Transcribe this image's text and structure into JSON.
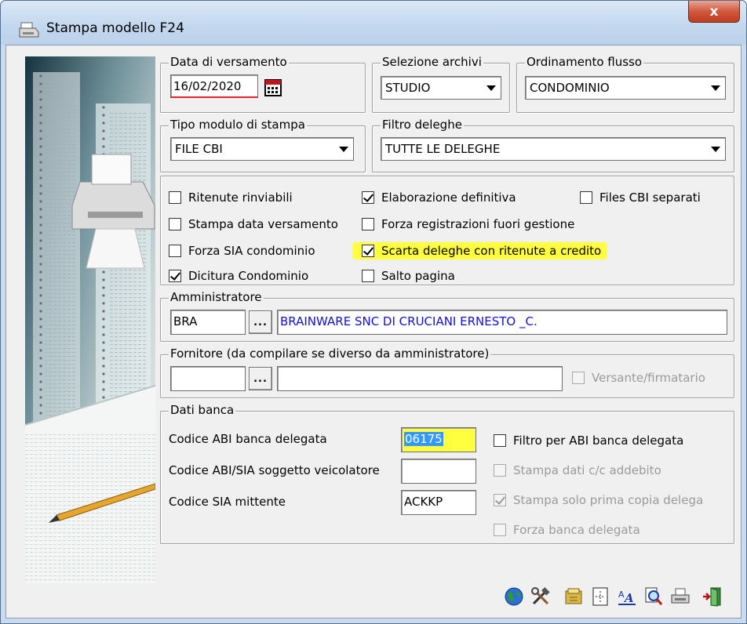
{
  "window": {
    "title": "Stampa modello F24",
    "close_label": "x"
  },
  "data_versamento": {
    "legend": "Data di versamento",
    "value": "16/02/2020"
  },
  "selezione_archivi": {
    "legend": "Selezione archivi",
    "value": "STUDIO"
  },
  "ordinamento_flusso": {
    "legend": "Ordinamento flusso",
    "value": "CONDOMINIO"
  },
  "tipo_modulo": {
    "legend": "Tipo modulo di stampa",
    "value": "FILE CBI"
  },
  "filtro_deleghe": {
    "legend": "Filtro deleghe",
    "value": "TUTTE LE DELEGHE"
  },
  "options": {
    "ritenute_rinviabili": {
      "label": "Ritenute rinviabili",
      "checked": false
    },
    "elaborazione_definitiva": {
      "label": "Elaborazione definitiva",
      "checked": true
    },
    "files_cbi_separati": {
      "label": "Files CBI separati",
      "checked": false
    },
    "stampa_data_versamento": {
      "label": "Stampa data versamento",
      "checked": false
    },
    "forza_registrazioni": {
      "label": "Forza registrazioni fuori gestione",
      "checked": false
    },
    "forza_sia_condominio": {
      "label": "Forza SIA condominio",
      "checked": false
    },
    "scarta_deleghe": {
      "label": "Scarta deleghe con ritenute a credito",
      "checked": true
    },
    "dicitura_condominio": {
      "label": "Dicitura Condominio",
      "checked": true
    },
    "salto_pagina": {
      "label": "Salto pagina",
      "checked": false
    }
  },
  "amministratore": {
    "legend": "Amministratore",
    "code": "BRA",
    "lookup_label": "...",
    "name": "BRAINWARE SNC DI CRUCIANI ERNESTO _C."
  },
  "fornitore": {
    "legend": "Fornitore (da compilare se diverso da amministratore)",
    "code": "",
    "lookup_label": "...",
    "name": "",
    "versante_label": "Versante/firmatario"
  },
  "dati_banca": {
    "legend": "Dati banca",
    "abi_label": "Codice ABI banca delegata",
    "abi_value": "06175",
    "abi_sia_label": "Codice ABI/SIA soggetto veicolatore",
    "abi_sia_value": "",
    "sia_mittente_label": "Codice SIA mittente",
    "sia_mittente_value": "ACKKP",
    "filtro_abi_label": "Filtro per ABI banca delegata",
    "stampa_dati_cc_label": "Stampa dati c/c addebito",
    "stampa_solo_prima_label": "Stampa solo prima copia delega",
    "forza_banca_label": "Forza banca delegata"
  },
  "colors": {
    "highlight": "#ffff40",
    "accent_text": "#1010d0",
    "date_underline": "#e0202a"
  },
  "toolbar": [
    "globe-icon",
    "tools-icon",
    "archive-icon",
    "page-setup-icon",
    "font-icon",
    "zoom-icon",
    "printer-icon",
    "exit-door-icon"
  ]
}
